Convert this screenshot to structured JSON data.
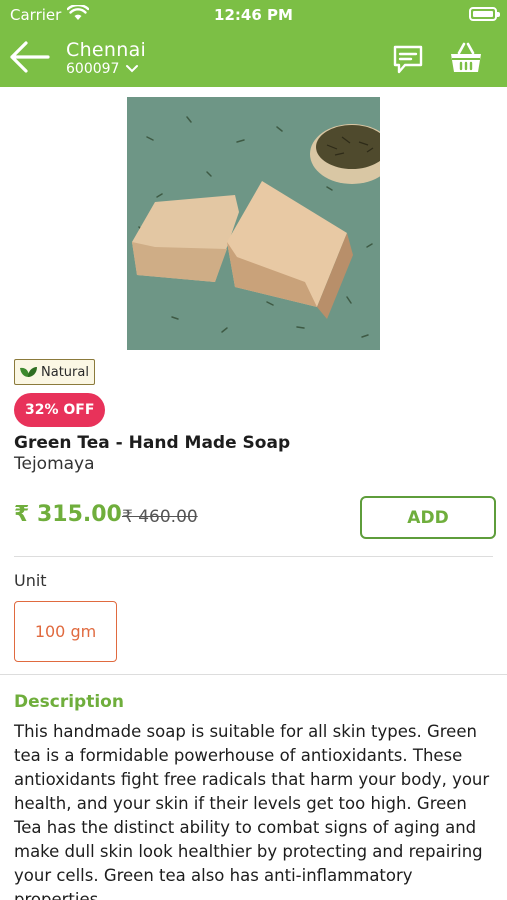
{
  "status_bar": {
    "carrier": "Carrier",
    "time": "12:46 PM"
  },
  "header": {
    "city": "Chennai",
    "pincode": "600097",
    "background_color": "#7cbf45",
    "icons": [
      "back-arrow-icon",
      "chevron-down-icon",
      "chat-icon",
      "basket-icon"
    ]
  },
  "product": {
    "image": "green-tea-soap-bars-with-tea-leaves-bowl",
    "badge_natural": "Natural",
    "discount": "32% OFF",
    "title": "Green Tea - Hand Made Soap",
    "brand": "Tejomaya",
    "price": "₹ 315.00",
    "mrp": "₹ 460.00",
    "add_label": "ADD"
  },
  "unit": {
    "label": "Unit",
    "selected": "100 gm"
  },
  "description": {
    "heading": "Description",
    "text": "This handmade soap is suitable for all skin types. Green tea is a formidable powerhouse of antioxidants. These antioxidants fight free radicals that harm your body, your health, and your skin if their levels get too high. Green Tea has the distinct ability to combat signs of aging and make dull skin look healthier by protecting and repairing your cells. Green tea also has anti-inflammatory properties"
  },
  "colors": {
    "accent": "#6fae3c",
    "discount": "#e8325a",
    "unit_selected": "#e06a3f"
  }
}
